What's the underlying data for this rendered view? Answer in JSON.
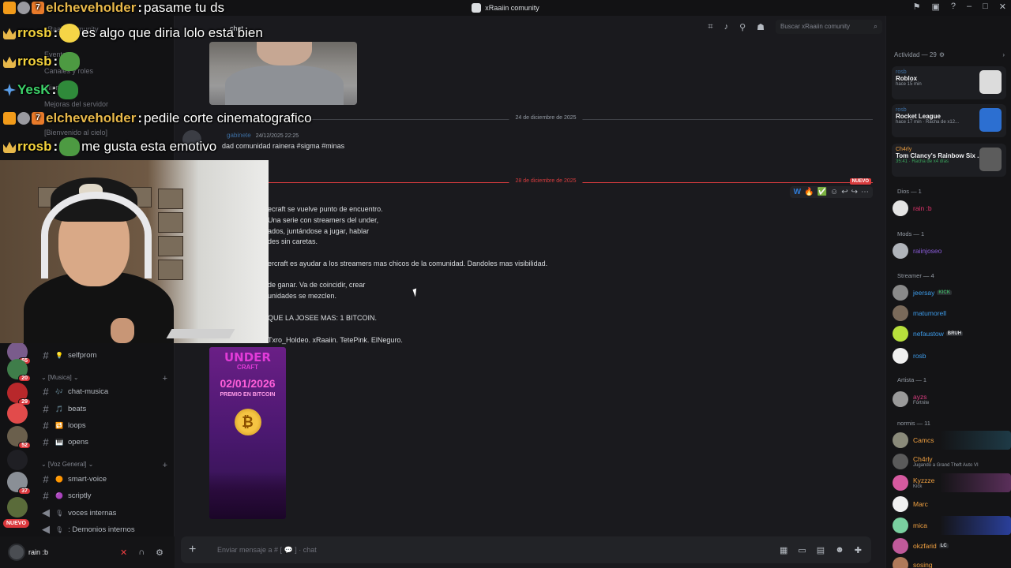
{
  "window": {
    "title": "xRaaiin comunity",
    "controls": [
      "flag-icon",
      "inbox-icon",
      "help-icon",
      "minimize-icon",
      "maximize-icon",
      "close-icon"
    ]
  },
  "server_rail": {
    "badges": [
      "65",
      "20",
      "29",
      "52",
      "37"
    ],
    "nuevo": "NUEVO"
  },
  "sidebar": {
    "server_name": "xRaaiin comunity",
    "faded_items": [
      "Eventos",
      "Canales y roles",
      "Miembros",
      "Mejoras del servidor",
      "[Bienvenido al cielo]"
    ],
    "channels": [
      {
        "emoji": "💡",
        "name": "selfprom"
      }
    ],
    "category_music": "⌄ [Musica] ⌄",
    "music_channels": [
      {
        "emoji": "🎶",
        "name": "chat-musica"
      },
      {
        "emoji": "🎵",
        "name": "beats"
      },
      {
        "emoji": "🔁",
        "name": "loops"
      },
      {
        "emoji": "🎹",
        "name": "opens"
      }
    ],
    "category_voice": "⌄ [Voz General] ⌄",
    "voice_channels": [
      {
        "emoji": "🟠",
        "name": "smart-voice"
      },
      {
        "emoji": "🟣",
        "name": "scriptly"
      },
      {
        "emoji": "🎙",
        "name": "voces internas"
      },
      {
        "emoji": "🎙",
        "name": ": Demonios internos"
      }
    ]
  },
  "user_panel": {
    "name": "rain :b"
  },
  "header": {
    "channel": "chat",
    "icons": [
      "threads-icon",
      "bell-icon",
      "pin-icon",
      "members-icon"
    ]
  },
  "messages": {
    "divider_1": "24 de diciembre de 2025",
    "author": "gabinete",
    "timestamp": "24/12/2025 22:25",
    "preview_text": "dad comunidad rainera #sigma #minas",
    "divider_2": "28 de diciembre de 2025",
    "nuevo_tag": "NUEVO",
    "lines": [
      "ecraft se vuelve punto de encuentro.",
      "Una serie con streamers del under,",
      "ados, juntándose a jugar, hablar",
      "des sin caretas.",
      "ercraft es ayudar a los streamers mas chicos de la comunidad. Dandoles mas visibilidad.",
      "de ganar. Va de coincidir, crear",
      "unidades se mezclen.",
      "QUE LA JOSEE MAS: 1 BITCOIN.",
      "Txro_Holdeo. xRaaiin. TetePink. ElNeguro."
    ],
    "reactions": [
      "W",
      "🔥",
      "✅"
    ],
    "poster": {
      "title": "UNDER",
      "subtitle": "CRAFT",
      "date": "02/01/2026",
      "prize": "PREMIO EN BITCOIN"
    }
  },
  "composer": {
    "placeholder": "Enviar mensaje a # [ 💬 ] · chat"
  },
  "right_panel": {
    "search_placeholder": "Buscar xRaaiin comunity",
    "activity_header": "Actividad — 29",
    "activity": [
      {
        "user": "rosb",
        "game": "Roblox",
        "detail": "hace 15 min"
      },
      {
        "user": "rosb",
        "game": "Rocket League",
        "detail": "hace 17 min · Racha de x12..."
      },
      {
        "user": "Ch4rly",
        "game": "Tom Clancy's Rainbow Six ...",
        "detail": "35:41 · Racha de x4 días"
      }
    ],
    "groups": [
      {
        "label": "Dios — 1",
        "members": [
          {
            "name": "rain :b",
            "status": "",
            "color": "#e0336b"
          }
        ]
      },
      {
        "label": "Mods — 1",
        "members": [
          {
            "name": "raiinjoseo",
            "status": "",
            "color": "#8a5cd9"
          }
        ]
      },
      {
        "label": "Streamer — 4",
        "members": [
          {
            "name": "jeersay",
            "tag": "KICK",
            "color": "#3d9be9"
          },
          {
            "name": "matumorell",
            "color": "#3d9be9"
          },
          {
            "name": "nefaustow",
            "tag": "BRUH",
            "color": "#3d9be9"
          },
          {
            "name": "rosb",
            "color": "#3d9be9"
          }
        ]
      },
      {
        "label": "Artista — 1",
        "members": [
          {
            "name": "ayzs",
            "status": "Fortnite",
            "color": "#d83c7e"
          }
        ]
      },
      {
        "label": "normis — 11",
        "members": [
          {
            "name": "Camcs",
            "color": "#f0a040"
          },
          {
            "name": "Ch4rly",
            "status": "Jugando a Grand Theft Auto VI",
            "color": "#f0a040"
          },
          {
            "name": "Kyzzze",
            "status": "Kick",
            "color": "#f0a040"
          },
          {
            "name": "Marc",
            "color": "#f0a040"
          },
          {
            "name": "mica",
            "color": "#f0a040"
          },
          {
            "name": "okzfarid",
            "tag": "LC",
            "color": "#f0a040"
          },
          {
            "name": "sosing",
            "color": "#f0a040"
          }
        ]
      }
    ]
  },
  "stream_chat": [
    {
      "user": "elcheveholder",
      "sep": ":",
      "message": "pasame tu ds"
    },
    {
      "user": "rrosb",
      "sep": ":",
      "message": "es algo que diria lolo esta bien"
    },
    {
      "user": "rrosb",
      "sep": ":",
      "message": ""
    },
    {
      "user": "YesK",
      "sep": ":",
      "message": ""
    },
    {
      "user": "elcheveholder",
      "sep": ":",
      "message": "pedile corte cinematografico"
    },
    {
      "user": "rrosb",
      "sep": ":",
      "message": "me gusta esta emotivo"
    }
  ]
}
